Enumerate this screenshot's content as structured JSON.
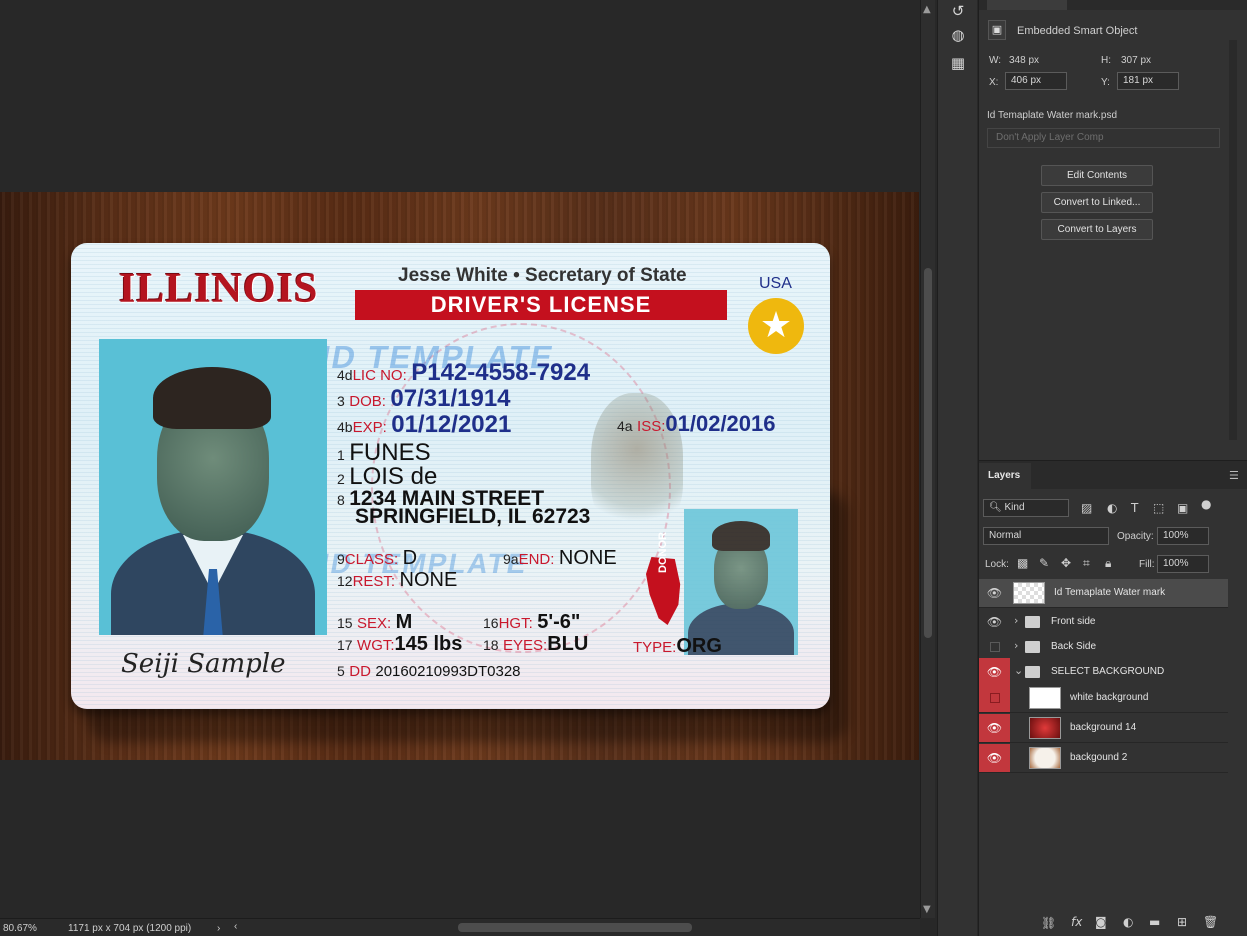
{
  "canvas": {
    "card": {
      "state": "ILLINOIS",
      "secretary": "Jesse White • Secretary of State",
      "title": "DRIVER'S LICENSE",
      "country": "USA",
      "watermark": "ID TEMPLATE",
      "fields": {
        "lic_num": "4d",
        "lic_label": "LIC NO:",
        "lic_value": "P142-4558-7924",
        "dob_num": "3",
        "dob_label": "DOB:",
        "dob_value": "07/31/1914",
        "exp_num": "4b",
        "exp_label": "EXP:",
        "exp_value": "01/12/2021",
        "iss_num": "4a",
        "iss_label": "ISS:",
        "iss_value": "01/02/2016",
        "last_num": "1",
        "last_value": "FUNES",
        "first_num": "2",
        "first_value": "LOIS de",
        "addr_num": "8",
        "addr_line1": "1234 MAIN STREET",
        "addr_line2": "SPRINGFIELD, IL 62723",
        "class_num": "9",
        "class_label": "CLASS:",
        "class_value": "D",
        "end_num": "9a",
        "end_label": "END:",
        "end_value": "NONE",
        "rest_num": "12",
        "rest_label": "REST:",
        "rest_value": "NONE",
        "sex_num": "15",
        "sex_label": "SEX:",
        "sex_value": "M",
        "hgt_num": "16",
        "hgt_label": "HGT:",
        "hgt_value": "5'-6\"",
        "wgt_num": "17",
        "wgt_label": "WGT:",
        "wgt_value": "145 lbs",
        "eyes_num": "18",
        "eyes_label": "EYES:",
        "eyes_value": "BLU",
        "dd_num": "5",
        "dd_label": "DD",
        "dd_value": "20160210993DT0328",
        "type_label": "TYPE:",
        "type_value": "ORG",
        "donor": "DONOR"
      },
      "signature": "Seiji Sample"
    }
  },
  "properties": {
    "kind": "Embedded Smart Object",
    "w_label": "W:",
    "w_value": "348 px",
    "h_label": "H:",
    "h_value": "307 px",
    "x_label": "X:",
    "x_value": "406 px",
    "y_label": "Y:",
    "y_value": "181 px",
    "filename": "Id Temaplate Water mark.psd",
    "layer_comp": "Don't Apply Layer Comp",
    "buttons": [
      "Edit Contents",
      "Convert to Linked...",
      "Convert to Layers"
    ]
  },
  "layers": {
    "tab": "Layers",
    "filter_kind": "Kind",
    "blend_mode": "Normal",
    "opacity_label": "Opacity:",
    "opacity_value": "100%",
    "lock_label": "Lock:",
    "fill_label": "Fill:",
    "fill_value": "100%",
    "items": [
      {
        "name": "Id Temaplate Water mark",
        "visible": true,
        "selected": true
      },
      {
        "name": "Front side",
        "visible": true
      },
      {
        "name": "Back Side",
        "visible": false
      },
      {
        "name": "SELECT BACKGROUND",
        "visible": true
      },
      {
        "name": "white background",
        "visible": false
      },
      {
        "name": "background 14",
        "visible": true
      },
      {
        "name": "backgound 2",
        "visible": true
      }
    ]
  },
  "status": {
    "zoom": "80.67%",
    "doc_info": "1171 px x 704 px (1200 ppi)"
  },
  "colors": {
    "accent_red": "#c2373d",
    "panel_bg": "#323232",
    "canvas_bg": "#282828"
  }
}
